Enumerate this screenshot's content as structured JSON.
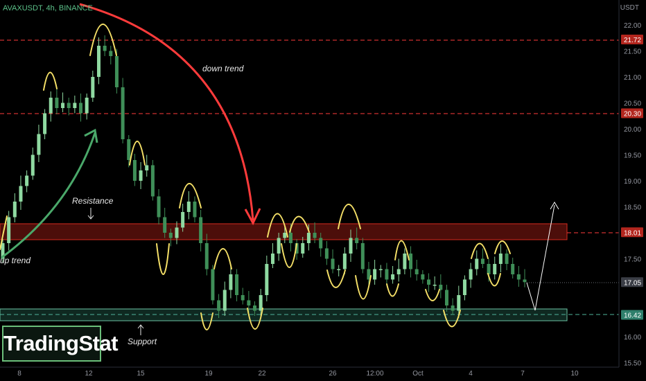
{
  "header": {
    "symbol": "AVAXUSDT, 4h, BINANCE",
    "currency": "USDT"
  },
  "annotations": {
    "down_trend": "down trend",
    "up_trend": "up trend",
    "resistance": "Resistance",
    "support": "Support",
    "watermark": "TradingStat"
  },
  "colors": {
    "background": "#000000",
    "candle_up": "#8fd9a1",
    "candle_down": "#3f8f58",
    "level_line": "#ff3b3b",
    "support_line": "#4fb39a",
    "resistance_zone": "#d42a1e",
    "support_zone": "#6bc4a4",
    "wave_marks": "#f4df67",
    "down_arrow": "#ff3b3b",
    "up_arrow": "#4aa86a",
    "projection": "#ffffff"
  },
  "chart_data": {
    "type": "candlestick",
    "title": "AVAXUSDT, 4h, BINANCE",
    "ylim": [
      15.5,
      22.2
    ],
    "y_ticks": [
      "22.00",
      "21.50",
      "21.00",
      "20.50",
      "20.00",
      "19.50",
      "19.00",
      "18.50",
      "17.50",
      "16.00",
      "15.50"
    ],
    "x_ticks": [
      "8",
      "12",
      "15",
      "19",
      "22",
      "26",
      "12:00",
      "Oct",
      "4",
      "7",
      "10"
    ],
    "price_labels": [
      {
        "label": "21.72",
        "value": 21.72,
        "kind": "level"
      },
      {
        "label": "20.30",
        "value": 20.3,
        "kind": "level"
      },
      {
        "label": "18.01",
        "value": 18.01,
        "kind": "level"
      },
      {
        "label": "17.05",
        "value": 17.05,
        "kind": "last"
      },
      {
        "label": "16.42",
        "value": 16.42,
        "kind": "support"
      }
    ],
    "resistance_zone": [
      17.88,
      18.18
    ],
    "support_zone": [
      16.32,
      16.52
    ],
    "grid": false,
    "series": [
      {
        "name": "close",
        "values": [
          17.8,
          18.3,
          18.6,
          18.9,
          19.1,
          19.5,
          19.9,
          20.3,
          20.6,
          20.4,
          20.5,
          20.4,
          20.5,
          20.3,
          20.6,
          21.0,
          21.6,
          21.5,
          21.4,
          20.8,
          19.8,
          19.4,
          19.0,
          19.2,
          19.3,
          18.7,
          18.3,
          18.0,
          17.9,
          18.1,
          18.4,
          18.6,
          18.3,
          17.8,
          17.3,
          16.7,
          16.5,
          16.9,
          17.2,
          16.8,
          16.7,
          16.6,
          16.5,
          16.8,
          17.4,
          17.6,
          17.9,
          18.0,
          17.8,
          17.6,
          17.8,
          18.0,
          17.9,
          17.7,
          17.5,
          17.3,
          17.3,
          17.6,
          17.9,
          17.8,
          17.3,
          17.1,
          17.3,
          17.3,
          17.1,
          17.2,
          17.3,
          17.6,
          17.3,
          17.2,
          17.1,
          17.0,
          17.0,
          16.9,
          16.6,
          16.5,
          16.8,
          17.1,
          17.3,
          17.5,
          17.4,
          17.2,
          17.4,
          17.6,
          17.4,
          17.2,
          17.1,
          17.05
        ]
      },
      {
        "name": "projection",
        "values": [
          17.05,
          16.42,
          18.6
        ]
      }
    ]
  }
}
